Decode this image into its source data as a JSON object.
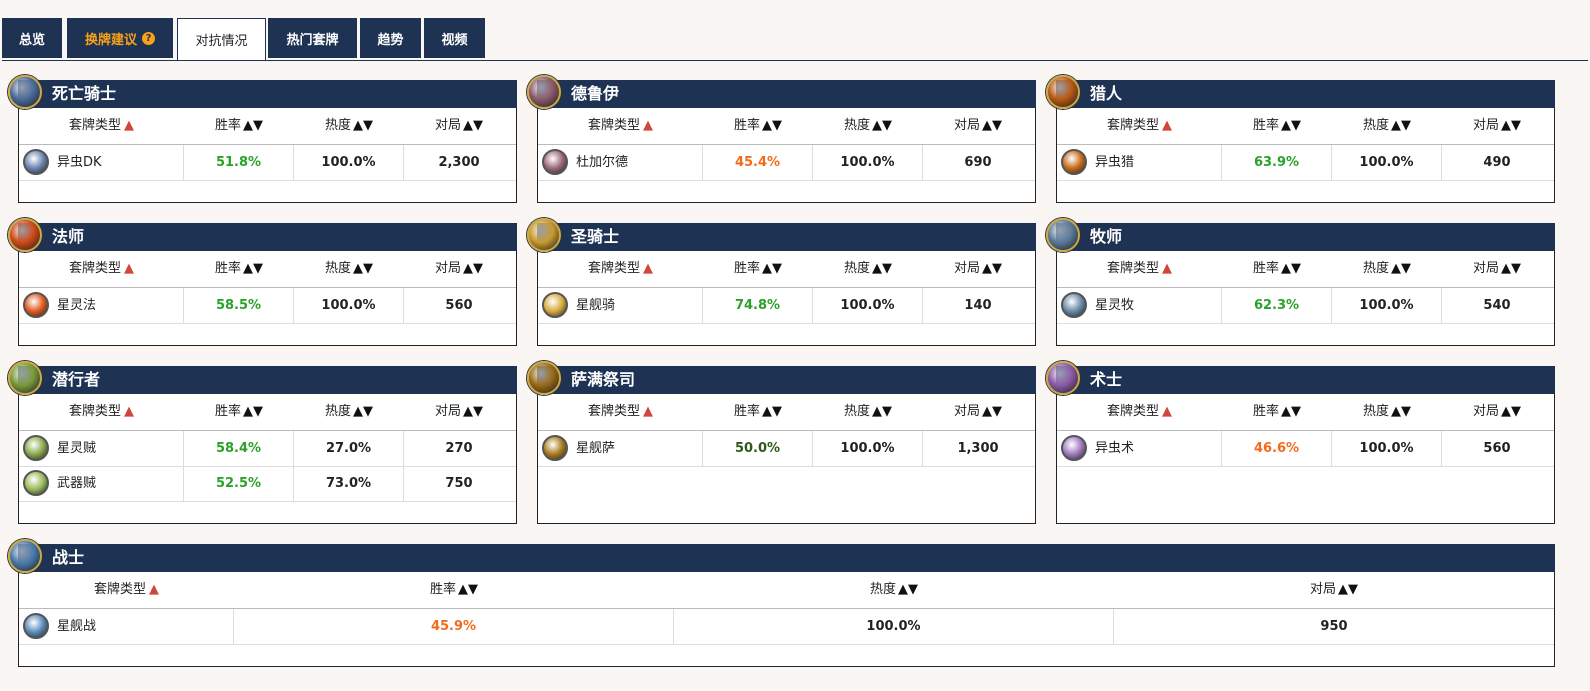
{
  "tabs": [
    {
      "label": "总览"
    },
    {
      "label": "换牌建议",
      "help": "?"
    },
    {
      "label": "对抗情况"
    },
    {
      "label": "热门套牌"
    },
    {
      "label": "趋势"
    },
    {
      "label": "视频"
    }
  ],
  "headers": {
    "deck": "套牌类型",
    "winrate": "胜率",
    "popularity": "热度",
    "games": "对局",
    "sort_up": "▲",
    "sort_both": "▲▼"
  },
  "classes": [
    {
      "name": "死亡骑士",
      "icon": "death-knight-icon",
      "color": "#4a6a9a",
      "decks": [
        {
          "name": "异虫DK",
          "winrate": "51.8%",
          "popularity": "100.0%",
          "games": "2,300",
          "wr_color": "green",
          "icon_color": "#6a84b0"
        }
      ]
    },
    {
      "name": "德鲁伊",
      "icon": "druid-icon",
      "color": "#8a5a6a",
      "decks": [
        {
          "name": "杜加尔德",
          "winrate": "45.4%",
          "popularity": "100.0%",
          "games": "690",
          "wr_color": "orange",
          "icon_color": "#9a6a78"
        }
      ]
    },
    {
      "name": "猎人",
      "icon": "hunter-icon",
      "color": "#b85a14",
      "decks": [
        {
          "name": "异虫猎",
          "winrate": "63.9%",
          "popularity": "100.0%",
          "games": "490",
          "wr_color": "green",
          "icon_color": "#c86a1a"
        }
      ]
    },
    {
      "name": "法师",
      "icon": "mage-icon",
      "color": "#d04a18",
      "decks": [
        {
          "name": "星灵法",
          "winrate": "58.5%",
          "popularity": "100.0%",
          "games": "560",
          "wr_color": "green",
          "icon_color": "#e05a20"
        }
      ]
    },
    {
      "name": "圣骑士",
      "icon": "paladin-icon",
      "color": "#c89a30",
      "decks": [
        {
          "name": "星舰骑",
          "winrate": "74.8%",
          "popularity": "100.0%",
          "games": "140",
          "wr_color": "green",
          "icon_color": "#d8aa40"
        }
      ]
    },
    {
      "name": "牧师",
      "icon": "priest-icon",
      "color": "#5a7a9a",
      "decks": [
        {
          "name": "星灵牧",
          "winrate": "62.3%",
          "popularity": "100.0%",
          "games": "540",
          "wr_color": "green",
          "icon_color": "#6a8aaa"
        }
      ]
    },
    {
      "name": "潜行者",
      "icon": "rogue-icon",
      "color": "#7a9a3a",
      "decks": [
        {
          "name": "星灵贼",
          "winrate": "58.4%",
          "popularity": "27.0%",
          "games": "270",
          "wr_color": "green",
          "icon_color": "#8aaa4a"
        },
        {
          "name": "武器贼",
          "winrate": "52.5%",
          "popularity": "73.0%",
          "games": "750",
          "wr_color": "green",
          "icon_color": "#9aba5a"
        }
      ]
    },
    {
      "name": "萨满祭司",
      "icon": "shaman-icon",
      "color": "#9a6a18",
      "decks": [
        {
          "name": "星舰萨",
          "winrate": "50.0%",
          "popularity": "100.0%",
          "games": "1,300",
          "wr_color": "dark",
          "icon_color": "#aa7a20"
        }
      ]
    },
    {
      "name": "术士",
      "icon": "warlock-icon",
      "color": "#8a5aa8",
      "decks": [
        {
          "name": "异虫术",
          "winrate": "46.6%",
          "popularity": "100.0%",
          "games": "560",
          "wr_color": "orange",
          "icon_color": "#a07ac0"
        }
      ]
    },
    {
      "name": "战士",
      "icon": "warrior-icon",
      "color": "#4a7aaa",
      "decks": [
        {
          "name": "星舰战",
          "winrate": "45.9%",
          "popularity": "100.0%",
          "games": "950",
          "wr_color": "orange",
          "icon_color": "#5a8aba"
        }
      ]
    }
  ]
}
